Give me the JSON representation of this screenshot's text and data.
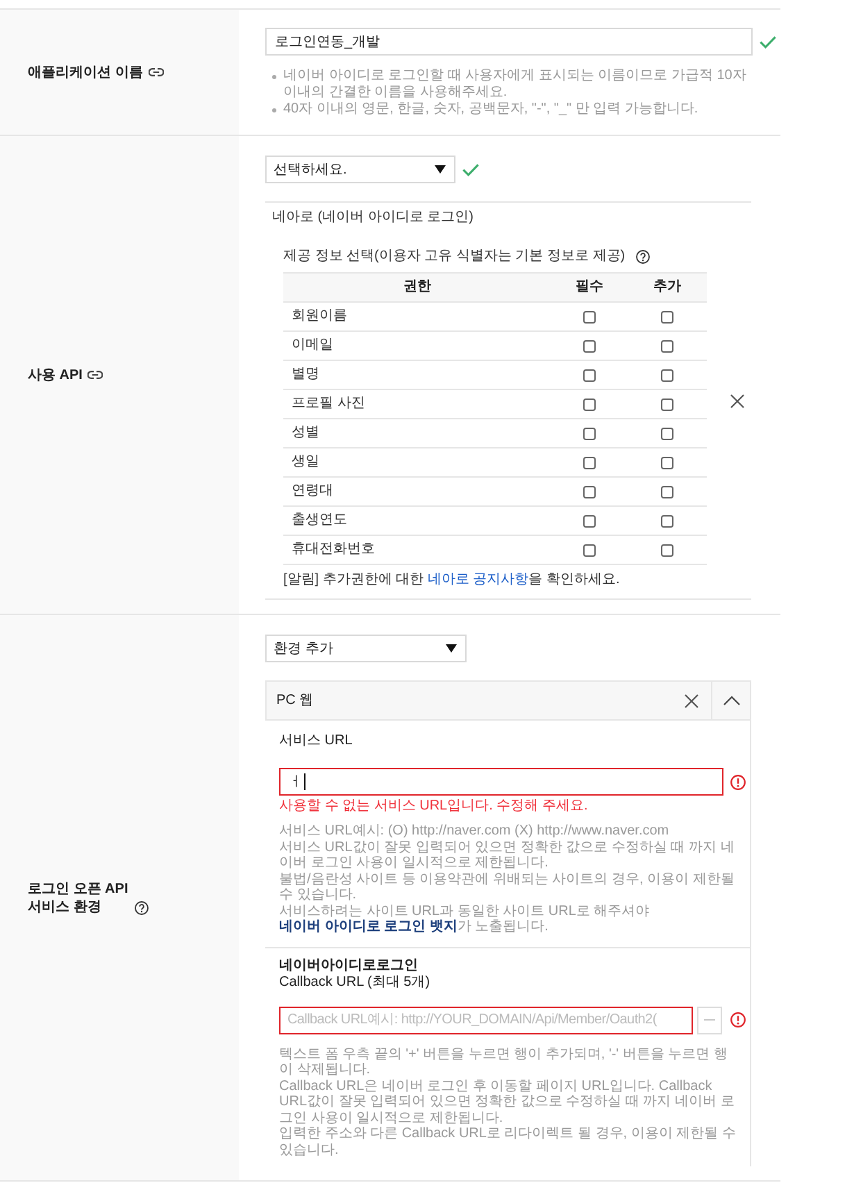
{
  "app_name": {
    "label": "애플리케이션 이름",
    "value": "로그인연동_개발",
    "valid": true,
    "hints": [
      "네이버 아이디로 로그인할 때 사용자에게 표시되는 이름이므로 가급적 10자 이내의 간결한 이름을 사용해주세요.",
      "40자 이내의 영문, 한글, 숫자, 공백문자, \"-\", \"_\" 만 입력 가능합니다."
    ]
  },
  "api": {
    "label": "사용 API",
    "select": {
      "value": "선택하세요.",
      "valid": true
    },
    "title": "네아로 (네이버 아이디로 로그인)",
    "info_title": "제공 정보 선택(이용자 고유 식별자는 기본 정보로 제공)",
    "table": {
      "columns": [
        "권한",
        "필수",
        "추가"
      ],
      "rows": [
        {
          "permission": "회원이름",
          "required": {
            "checked": false
          },
          "additional": {
            "checked": false
          }
        },
        {
          "permission": "이메일",
          "required": {
            "checked": false
          },
          "additional": {
            "checked": false
          }
        },
        {
          "permission": "별명",
          "required": {
            "checked": false
          },
          "additional": {
            "checked": false
          }
        },
        {
          "permission": "프로필 사진",
          "required": {
            "checked": false
          },
          "additional": {
            "checked": false
          }
        },
        {
          "permission": "성별",
          "required": {
            "checked": false
          },
          "additional": {
            "checked": false
          }
        },
        {
          "permission": "생일",
          "required": {
            "checked": false
          },
          "additional": {
            "checked": false
          }
        },
        {
          "permission": "연령대",
          "required": {
            "checked": false
          },
          "additional": {
            "checked": false
          }
        },
        {
          "permission": "출생연도",
          "required": {
            "checked": false
          },
          "additional": {
            "checked": false
          }
        },
        {
          "permission": "휴대전화번호",
          "required": {
            "checked": false
          },
          "additional": {
            "checked": false
          }
        }
      ]
    },
    "notice": {
      "text": "[알림] 추가권한에 대한 ",
      "link": "네아로 공지사항",
      "after": "을 확인하세요."
    }
  },
  "environment": {
    "label": "로그인 오픈 API\n서비스 환경",
    "select": {
      "value": "환경 추가"
    },
    "panels": [
      {
        "title": "PC 웹",
        "expanded": true,
        "service_url": {
          "label": "서비스 URL",
          "value": "ㅓ",
          "focused": true,
          "invalid": true,
          "error": "사용할 수 없는 서비스 URL입니다. 수정해 주세요.",
          "hints": [
            {
              "text": "서비스 URL예시: (O) http://naver.com (X) http://www.naver.com"
            },
            {
              "text": "서비스 URL값이 잘못 입력되어 있으면 정확한 값으로 수정하실 때 까지 네이버 로그인 사용이 일시적으로 제한됩니다."
            },
            {
              "text": "불법/음란성 사이트 등 이용약관에 위배되는 사이트의 경우, 이용이 제한될 수 있습니다."
            },
            {
              "text": "서비스하려는 사이트 URL과 동일한 사이트 URL로 해주셔야 ",
              "link": "네이버 아이디로 로그인 뱃지",
              "after": "가 노출됩니다."
            }
          ]
        },
        "callback": {
          "title": "네이버아이디로로그인",
          "subtitle": "Callback URL (최대 5개)",
          "placeholder": "Callback URL예시: http://YOUR_DOMAIN/Api/Member/Oauth2(",
          "invalid": true,
          "remove_button": {
            "disabled": true
          },
          "hints": [
            {
              "text": "텍스트 폼 우측 끝의 '+' 버튼을 누르면 행이 추가되며, '-' 버튼을 누르면 행이 삭제됩니다."
            },
            {
              "text": "Callback URL은 네이버 로그인 후 이동할 페이지 URL입니다. Callback URL값이 잘못 입력되어 있으면 정확한 값으로 수정하실 때 까지 네이버 로그인 사용이 일시적으로 제한됩니다."
            },
            {
              "text": "입력한 주소와 다른 Callback URL로 리다이렉트 될 경우, 이용이 제한될 수 있습니다."
            }
          ]
        }
      }
    ]
  }
}
